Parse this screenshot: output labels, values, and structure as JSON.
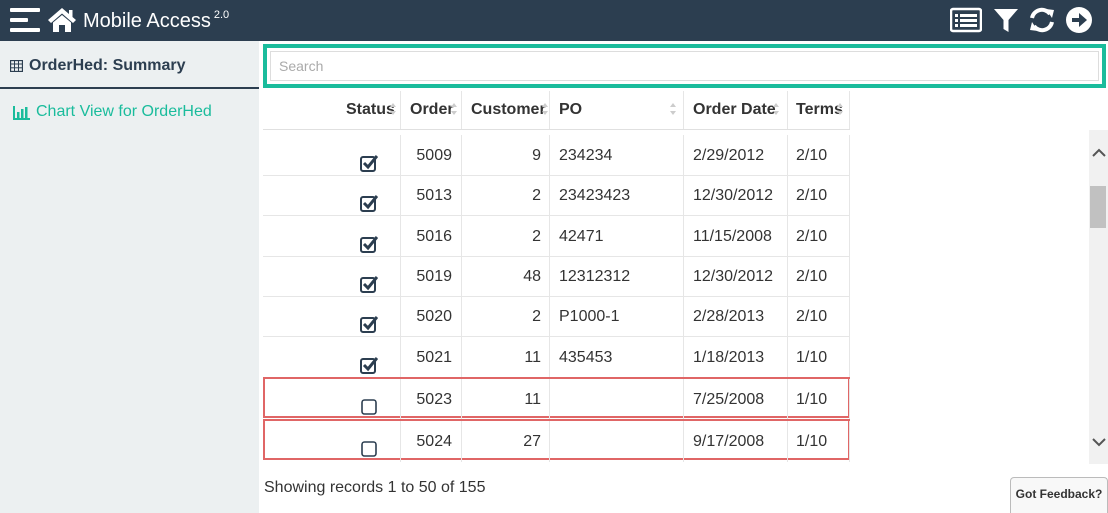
{
  "app": {
    "title": "Mobile Access",
    "version": "2.0"
  },
  "toolbar_icons": [
    "list-view-icon",
    "filter-icon",
    "refresh-icon",
    "logout-icon"
  ],
  "sidebar": {
    "title": "OrderHed: Summary",
    "links": [
      {
        "label": "Chart View for OrderHed",
        "icon": "bar-chart-icon"
      }
    ]
  },
  "search": {
    "placeholder": "Search",
    "value": ""
  },
  "table": {
    "columns": [
      "Status",
      "Order",
      "Customer",
      "PO",
      "Order Date",
      "Terms"
    ],
    "rows": [
      {
        "status": true,
        "order": "5009",
        "customer": "9",
        "po": "234234",
        "order_date": "2/29/2012",
        "terms": "2/10"
      },
      {
        "status": true,
        "order": "5013",
        "customer": "2",
        "po": "23423423",
        "order_date": "12/30/2012",
        "terms": "2/10"
      },
      {
        "status": true,
        "order": "5016",
        "customer": "2",
        "po": "42471",
        "order_date": "11/15/2008",
        "terms": "2/10"
      },
      {
        "status": true,
        "order": "5019",
        "customer": "48",
        "po": "12312312",
        "order_date": "12/30/2012",
        "terms": "2/10"
      },
      {
        "status": true,
        "order": "5020",
        "customer": "2",
        "po": "P1000-1",
        "order_date": "2/28/2013",
        "terms": "2/10"
      },
      {
        "status": true,
        "order": "5021",
        "customer": "11",
        "po": "435453",
        "order_date": "1/18/2013",
        "terms": "1/10"
      },
      {
        "status": false,
        "order": "5023",
        "customer": "11",
        "po": "",
        "order_date": "7/25/2008",
        "terms": "1/10",
        "highlighted": true
      },
      {
        "status": false,
        "order": "5024",
        "customer": "27",
        "po": "",
        "order_date": "9/17/2008",
        "terms": "1/10",
        "highlighted": true
      }
    ]
  },
  "footer": {
    "records_text": "Showing records 1 to 50 of 155",
    "feedback_label": "Got Feedback?"
  },
  "colors": {
    "topbar": "#2c3e50",
    "accent": "#1abc9c",
    "sidebar_bg": "#ecf0f1",
    "row_highlight_border": "#e06666"
  }
}
